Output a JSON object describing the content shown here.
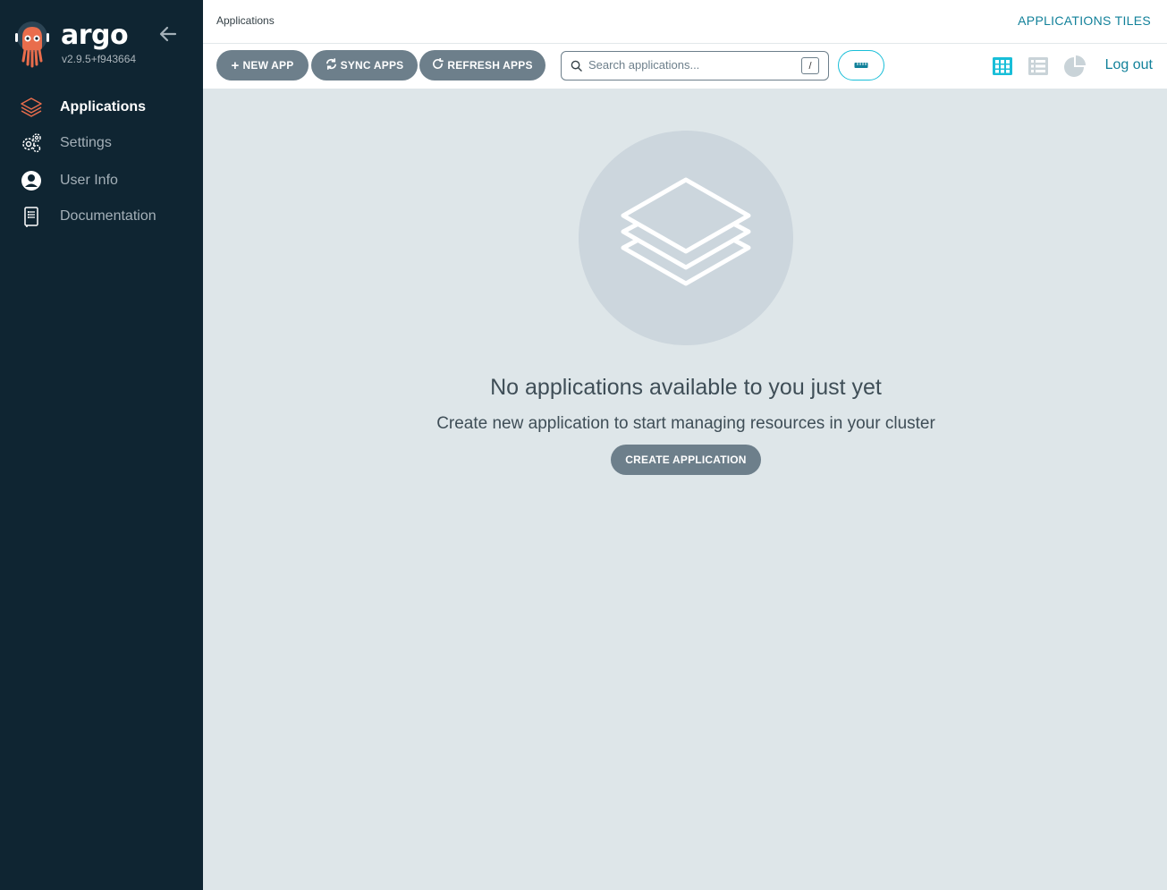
{
  "sidebar": {
    "brand": "argo",
    "version": "v2.9.5+f943664",
    "items": [
      {
        "label": "Applications",
        "icon": "layers-icon",
        "active": true
      },
      {
        "label": "Settings",
        "icon": "gears-icon",
        "active": false
      },
      {
        "label": "User Info",
        "icon": "user-circle-icon",
        "active": false
      },
      {
        "label": "Documentation",
        "icon": "book-icon",
        "active": false
      }
    ]
  },
  "header": {
    "breadcrumb": "Applications",
    "view_title": "APPLICATIONS TILES"
  },
  "toolbar": {
    "new_app": "NEW APP",
    "sync_apps": "SYNC APPS",
    "refresh_apps": "REFRESH APPS",
    "search_placeholder": "Search applications...",
    "search_value": "",
    "search_shortcut": "/",
    "logout": "Log out"
  },
  "empty_state": {
    "title": "No applications available to you just yet",
    "subtitle": "Create new application to start managing resources in your cluster",
    "button": "CREATE APPLICATION"
  },
  "colors": {
    "sidebar_bg": "#0f2532",
    "content_bg": "#dee6e9",
    "button_bg": "#6d7f8b",
    "accent": "#12819a",
    "accent_bright": "#18bed8",
    "brand_orange": "#e96d4c"
  }
}
